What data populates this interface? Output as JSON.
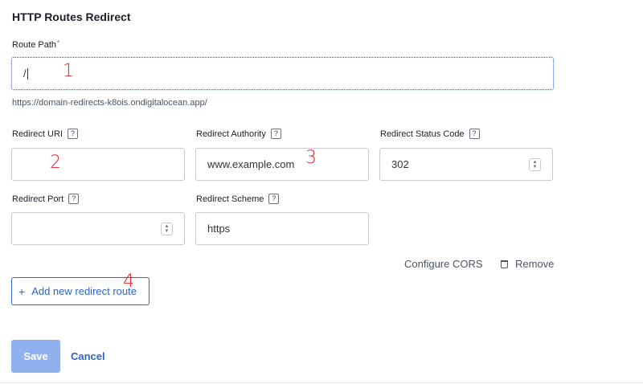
{
  "section": {
    "title": "HTTP Routes Redirect"
  },
  "route_path": {
    "label": "Route Path",
    "required_marker": "*",
    "value": "/",
    "hint": "https://domain-redirects-k8ois.ondigitalocean.app/"
  },
  "redirect_uri": {
    "label": "Redirect URI",
    "help": "?",
    "value": ""
  },
  "redirect_authority": {
    "label": "Redirect Authority",
    "help": "?",
    "value": "www.example.com"
  },
  "redirect_status_code": {
    "label": "Redirect Status Code",
    "help": "?",
    "value": "302"
  },
  "redirect_port": {
    "label": "Redirect Port",
    "help": "?",
    "value": ""
  },
  "redirect_scheme": {
    "label": "Redirect Scheme",
    "help": "?",
    "value": "https"
  },
  "actions": {
    "configure_cors": "Configure CORS",
    "remove": "Remove",
    "add_route_plus": "+",
    "add_route": "Add new redirect route",
    "save": "Save",
    "cancel": "Cancel"
  },
  "annotations": [
    "1",
    "2",
    "3",
    "4"
  ],
  "colors": {
    "accent": "#2f64c5",
    "save_disabled": "#8fb1ee",
    "annotation": "#e0242b"
  },
  "icons": {
    "remove": "trash-icon",
    "stepper": "stepper-icon"
  }
}
